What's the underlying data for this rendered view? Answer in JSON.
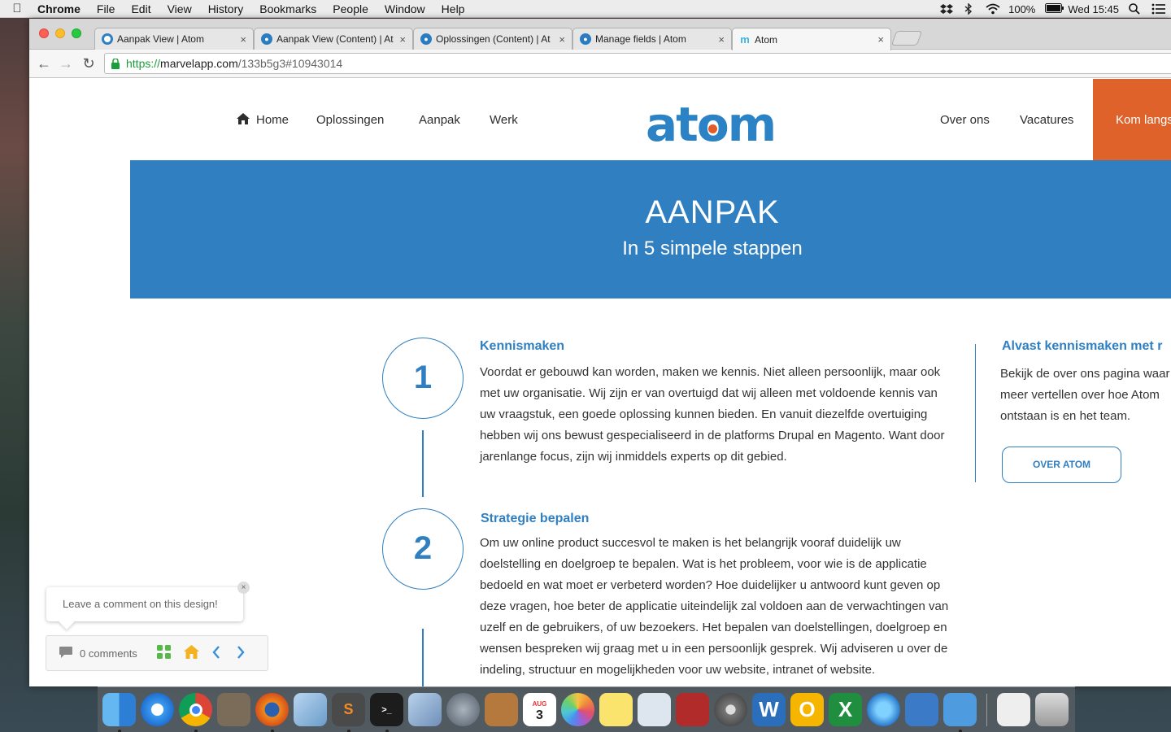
{
  "menubar": {
    "app": "Chrome",
    "items": [
      "File",
      "Edit",
      "View",
      "History",
      "Bookmarks",
      "People",
      "Window",
      "Help"
    ],
    "battery": "100%",
    "clock": "Wed 15:45"
  },
  "browser": {
    "tabs": [
      {
        "title": "Aanpak View | Atom",
        "favicon_color": "#2f7fc1"
      },
      {
        "title": "Aanpak View (Content) | At",
        "favicon_color": "#2b7bc0"
      },
      {
        "title": "Oplossingen (Content) | At",
        "favicon_color": "#2b7bc0"
      },
      {
        "title": "Manage fields | Atom",
        "favicon_color": "#2b7bc0"
      },
      {
        "title": "Atom",
        "favicon_color": "#37b5e6"
      }
    ],
    "url_scheme": "https://",
    "url_host": "marvelapp.com",
    "url_path": "/133b5g3#10943014"
  },
  "site": {
    "nav_left": [
      "Home",
      "Oplossingen",
      "Aanpak",
      "Werk"
    ],
    "logo_text": [
      "at",
      "o",
      "m"
    ],
    "nav_right": [
      "Over ons",
      "Vacatures"
    ],
    "cta": "Kom langs",
    "brand_blue": "#2f7fc1",
    "brand_orange": "#e0622b"
  },
  "hero": {
    "title": "AANPAK",
    "subtitle": "In 5 simpele stappen"
  },
  "steps": [
    {
      "number": "1",
      "title": "Kennismaken",
      "text": "Voordat er gebouwd kan worden, maken we kennis. Niet alleen persoonlijk, maar ook met uw organisatie. Wij zijn er van overtuigd dat wij alleen met voldoende kennis van uw vraagstuk, een goede oplossing kunnen bieden. En vanuit diezelfde overtuiging hebben wij ons bewust gespecialiseerd in de platforms Drupal en Magento. Want door jarenlange focus, zijn wij inmiddels experts op dit gebied."
    },
    {
      "number": "2",
      "title": "Strategie bepalen",
      "text": "Om uw online product succesvol te maken is het belangrijk vooraf duidelijk uw doelstelling en doelgroep te bepalen. Wat is het probleem, voor wie is de applicatie bedoeld en wat moet er verbeterd worden? Hoe duidelijker u antwoord kunt geven op deze vragen, hoe beter de applicatie uiteindelijk zal voldoen aan de verwachtingen van uzelf en de gebruikers, of uw bezoekers. Het bepalen van doelstellingen, doelgroep en wensen bespreken wij graag met u in een persoonlijk gesprek. Wij adviseren u over de indeling, structuur en mogelijkheden voor uw website, intranet of website."
    }
  ],
  "sidebar": {
    "title": "Alvast kennismaken met r",
    "text": "Bekijk de over ons pagina waar meer vertellen over hoe Atom ontstaan is en het team.",
    "button": "OVER ATOM"
  },
  "marvel": {
    "comment_prompt": "Leave a comment on this design!",
    "comment_count": "0 comments",
    "close": "×"
  },
  "dock": {
    "calendar_month": "AUG",
    "calendar_day": "3"
  }
}
